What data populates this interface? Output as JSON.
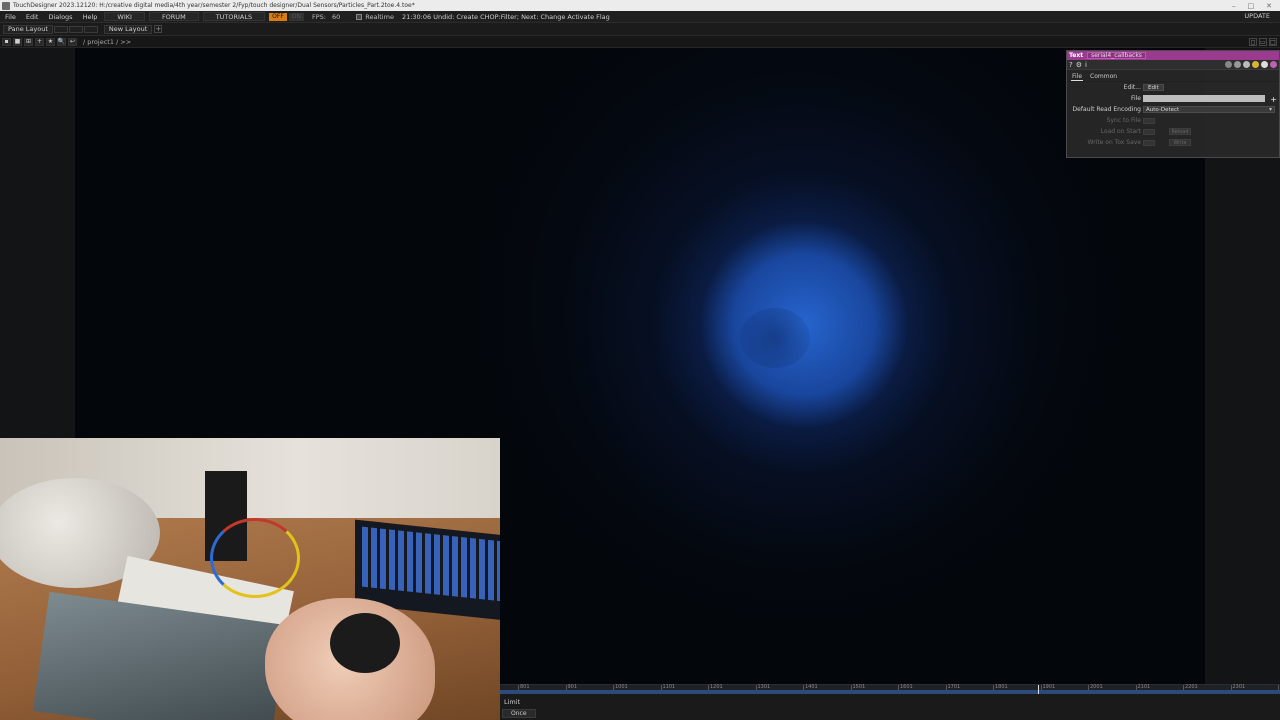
{
  "window": {
    "title": "TouchDesigner 2023.12120: H:/creative digital media/4th year/semester 2/Fyp/touch designer/Dual Sensors/Particles_Part.2toe.4.toe*",
    "controls": [
      "–",
      "□",
      "✕"
    ]
  },
  "menubar": {
    "items": [
      "File",
      "Edit",
      "Dialogs",
      "Help"
    ],
    "wiki": "WIKI",
    "forum": "FORUM",
    "tutorials": "TUTORIALS",
    "badge_on": "OFF",
    "badge_off": "ON",
    "fps_label": "FPS:",
    "fps_value": "60",
    "realtime": "Realtime",
    "status": "21:30:06 Undid: Create CHOP:Filter; Next: Change Activate Flag",
    "update": "UPDATE"
  },
  "layoutbar": {
    "pane_layout": "Pane Layout",
    "new_layout": "New Layout",
    "add": "+"
  },
  "pathbar": {
    "tools": [
      "▪",
      "■",
      "⊞",
      "+",
      "★",
      "🔍",
      "↩"
    ],
    "path": "/ project1 / >>",
    "pane_controls": [
      "◻",
      "▭",
      "□"
    ]
  },
  "param_panel": {
    "type": "Text",
    "name": "serial4_callbacks",
    "icons": [
      "?",
      "⚙",
      "i"
    ],
    "tabs": [
      "File",
      "Common"
    ],
    "rows": {
      "edit_label": "Edit...",
      "edit_btn": "Edit",
      "file_label": "File",
      "file_add": "+",
      "encoding_label": "Default Read Encoding",
      "encoding_value": "Auto-Detect",
      "sync_label": "Sync to File",
      "load_label": "Load on Start",
      "load_btn": "Reload",
      "write_label": "Write on Tox Save",
      "write_btn": "Write"
    }
  },
  "timeline": {
    "ticks": [
      "801",
      "901",
      "1001",
      "1101",
      "1201",
      "1301",
      "1401",
      "1501",
      "1601",
      "1701",
      "1801",
      "1901",
      "2001",
      "2101",
      "2201",
      "2301",
      "2401"
    ],
    "limit": "Limit",
    "once": "Once"
  }
}
